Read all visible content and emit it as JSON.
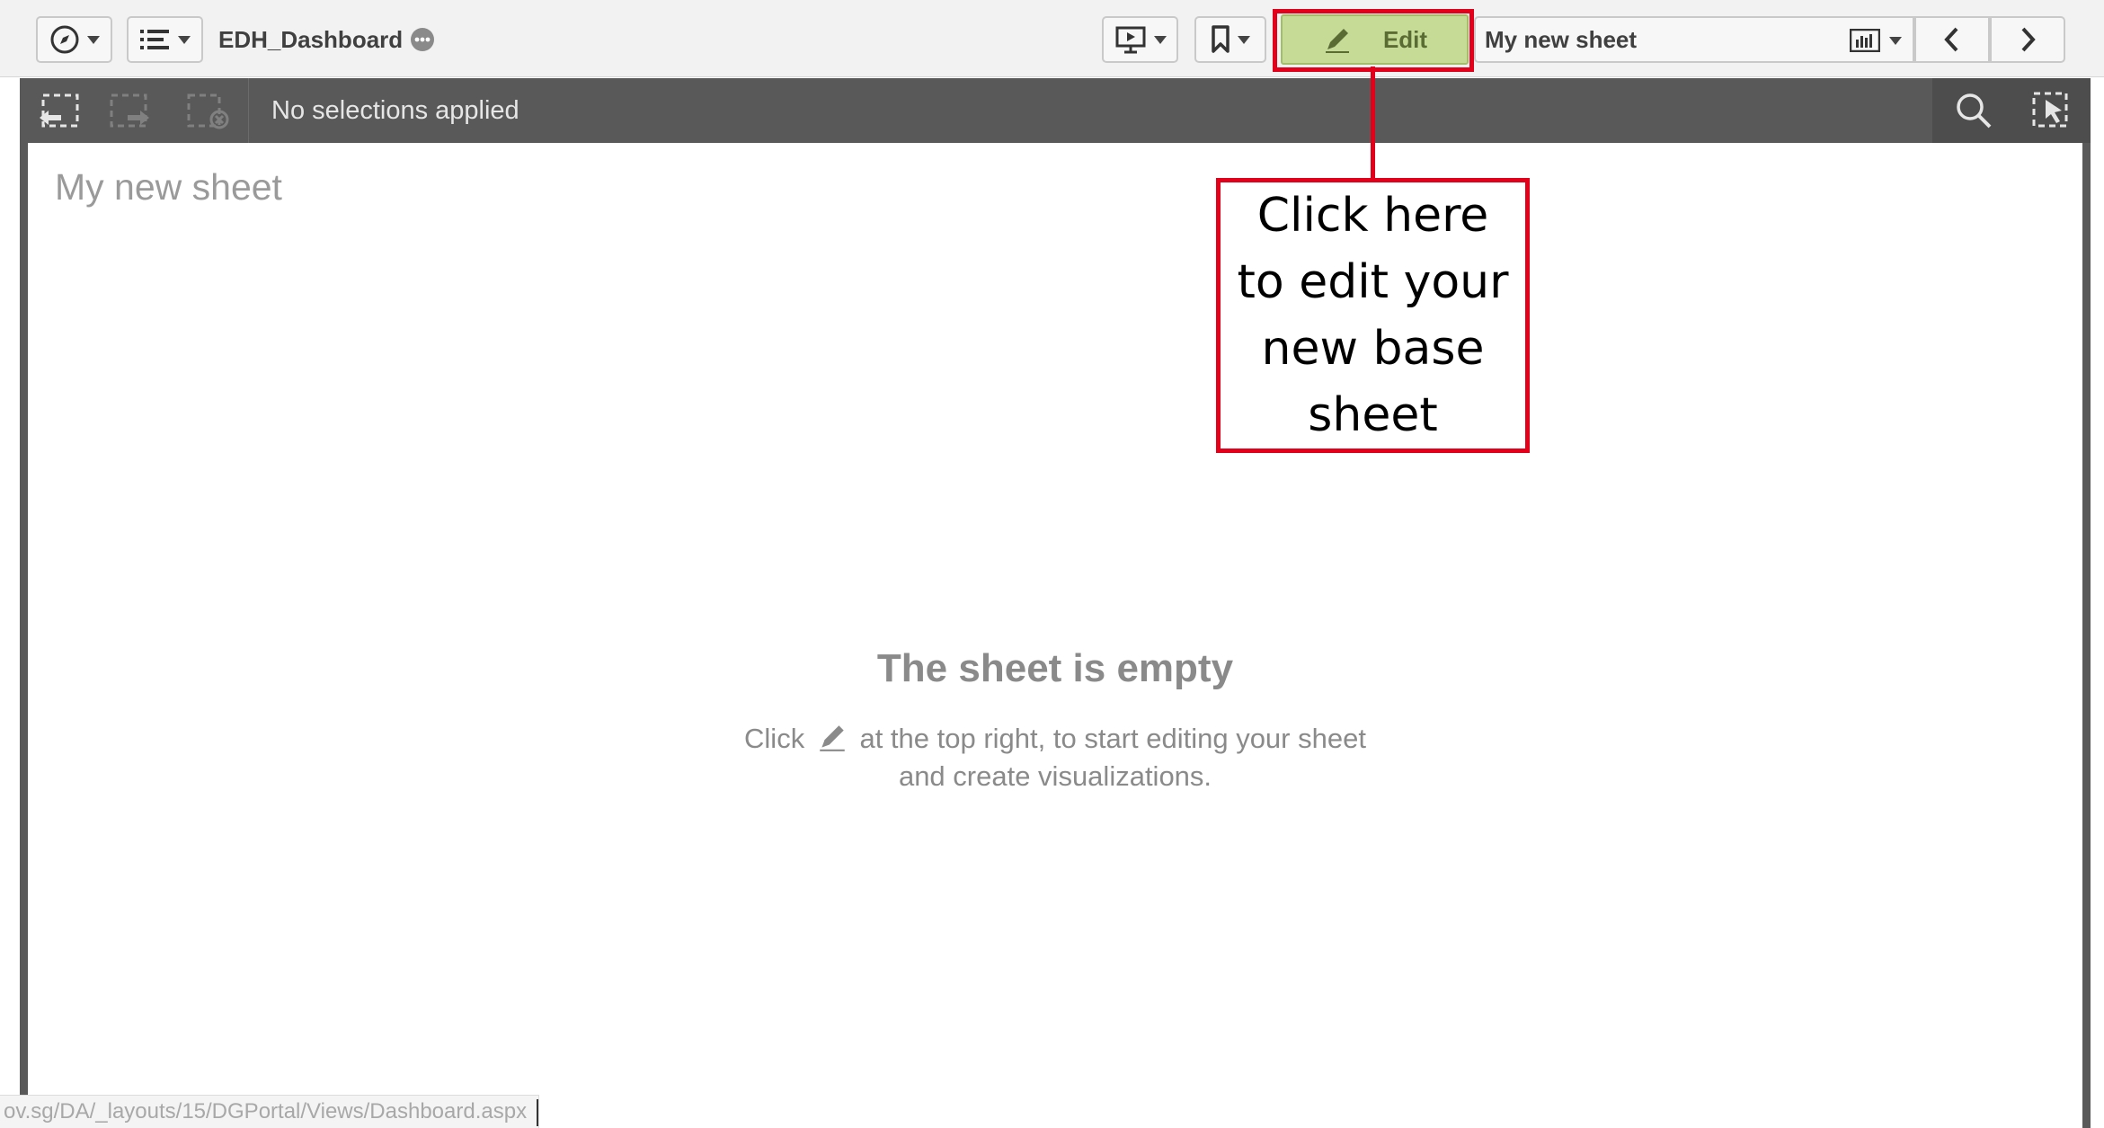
{
  "toolbar": {
    "app_title": "EDH_Dashboard",
    "edit_label": "Edit",
    "sheet_name": "My new sheet"
  },
  "selections": {
    "status": "No selections applied"
  },
  "sheet": {
    "title": "My new sheet",
    "empty_title": "The sheet is empty",
    "empty_desc_prefix": "Click",
    "empty_desc_suffix": "at the top right, to start editing your sheet",
    "empty_desc_line2": "and create visualizations."
  },
  "statusbar": {
    "url": "ov.sg/DA/_layouts/15/DGPortal/Views/Dashboard.aspx"
  },
  "annotation": {
    "line1": "Click here",
    "line2": "to edit your",
    "line3": "new base",
    "line4": "sheet"
  },
  "colors": {
    "annotation": "#e3001b",
    "edit_button": "#c6dc96",
    "selection_bar": "#595959"
  }
}
